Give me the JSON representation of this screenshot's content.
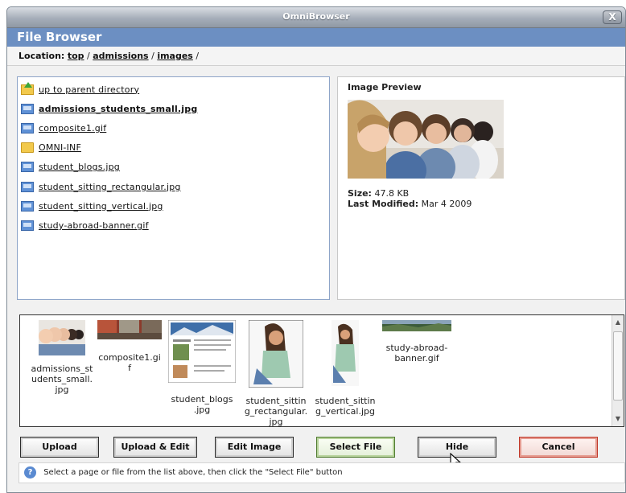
{
  "window": {
    "title": "OmniBrowser",
    "close_label": "X"
  },
  "header": {
    "title": "File Browser"
  },
  "location": {
    "label": "Location:",
    "crumbs": [
      "top",
      "admissions",
      "images"
    ],
    "sep": "/"
  },
  "files": [
    {
      "name": "up to parent directory",
      "icon": "up-folder-icon",
      "bold": false
    },
    {
      "name": "admissions_students_small.jpg",
      "icon": "image-file-icon",
      "bold": true
    },
    {
      "name": "composite1.gif",
      "icon": "image-file-icon",
      "bold": false
    },
    {
      "name": "OMNI-INF",
      "icon": "folder-icon",
      "bold": false
    },
    {
      "name": "student_blogs.jpg",
      "icon": "image-file-icon",
      "bold": false
    },
    {
      "name": "student_sitting_rectangular.jpg",
      "icon": "image-file-icon",
      "bold": false
    },
    {
      "name": "student_sitting_vertical.jpg",
      "icon": "image-file-icon",
      "bold": false
    },
    {
      "name": "study-abroad-banner.gif",
      "icon": "image-file-icon",
      "bold": false
    }
  ],
  "preview": {
    "title": "Image Preview",
    "size_label": "Size:",
    "size_value": "47.8 KB",
    "modified_label": "Last Modified:",
    "modified_value": "Mar 4 2009"
  },
  "thumbnails": [
    {
      "caption": "admissions_st\nudents_small.\njpg"
    },
    {
      "caption": "composite1.gi\nf"
    },
    {
      "caption": "student_blogs\n.jpg"
    },
    {
      "caption": "student_sittin\ng_rectangular.\njpg"
    },
    {
      "caption": "student_sittin\ng_vertical.jpg"
    },
    {
      "caption": "study-abroad-\nbanner.gif"
    }
  ],
  "buttons": {
    "upload": "Upload",
    "upload_edit": "Upload & Edit",
    "edit_image": "Edit Image",
    "select_file": "Select File",
    "hide_thumbnails": "Hide Thumbnails",
    "cancel": "Cancel"
  },
  "status": {
    "message": "Select a page or file from the list above, then click the \"Select File\" button"
  },
  "colors": {
    "header": "#6c8fc2",
    "select_border": "#4f7a2f",
    "cancel_border": "#c0392b"
  }
}
